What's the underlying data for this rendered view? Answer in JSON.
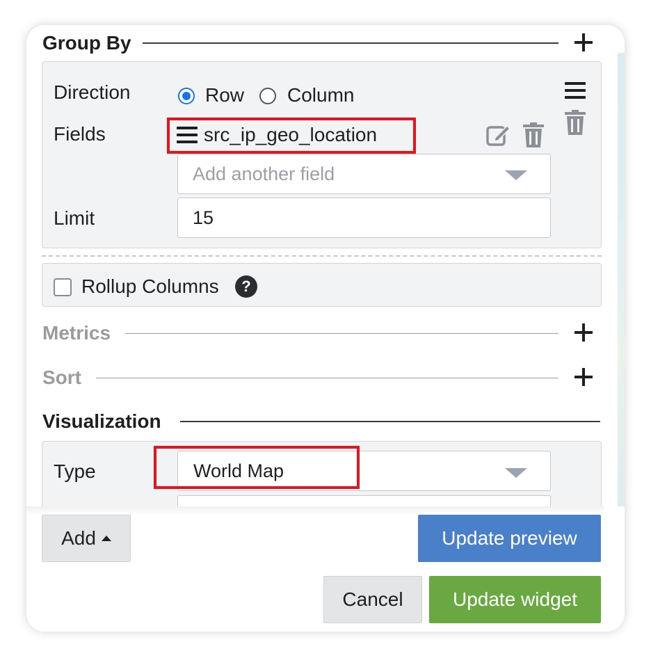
{
  "group_by": {
    "title": "Group By",
    "direction_label": "Direction",
    "direction_options": [
      "Row",
      "Column"
    ],
    "direction_selected": "Row",
    "fields_label": "Fields",
    "field_value": "src_ip_geo_location",
    "add_field_placeholder": "Add another field",
    "limit_label": "Limit",
    "limit_value": "15"
  },
  "rollup": {
    "label": "Rollup Columns",
    "checked": false,
    "help_glyph": "?"
  },
  "metrics": {
    "title": "Metrics"
  },
  "sort": {
    "title": "Sort"
  },
  "visualization": {
    "title": "Visualization",
    "type_label": "Type",
    "type_value": "World Map"
  },
  "footer": {
    "add_label": "Add",
    "update_preview_label": "Update preview",
    "cancel_label": "Cancel",
    "update_widget_label": "Update widget"
  },
  "icons": [
    "plus-icon",
    "hamburger-icon",
    "edit-icon",
    "trash-icon",
    "help-icon",
    "caret-down-icon",
    "caret-up-icon"
  ],
  "colors": {
    "accent_blue": "#1a73e8",
    "update_preview": "#4a80c9",
    "update_widget": "#6aa942",
    "highlight_red": "#e8141d"
  }
}
